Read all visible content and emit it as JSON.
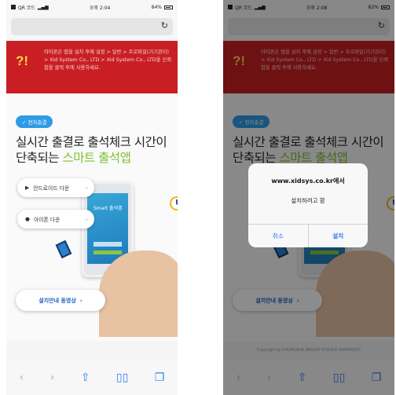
{
  "left": {
    "status": {
      "carrier": "QR 코드",
      "time": "오후 2:04",
      "battery": "84%"
    },
    "banner": {
      "mark": "?!",
      "text": "아이폰은 앱을 설치 후에 설정 > 일반 > 프로파일(기기관리) > Xid System Co., LTD > Xid System Co., LTD을 신뢰함을 클릭 후에 사용하세요."
    },
    "badge": "✓ 전자출결",
    "headline_line1": "실시간 출결로 출석체크 시간이",
    "headline_line2_plain": "단축되는 ",
    "headline_line2_green": "스마트 출석앱",
    "android_btn": "안드로이드 다운",
    "ios_btn": "아이폰 다운",
    "phone_app_label": "Smart 출석앱",
    "guide_btn": "설치안내 동영상"
  },
  "right": {
    "status": {
      "carrier": "QR 코드",
      "time": "오후 2:08",
      "battery": "82%"
    },
    "banner": {
      "mark": "?!",
      "text": "아이폰은 앱을 설치 후에 설정 > 일반 > 프로파일(기기관리) > Xid System Co., LTD > Xid System Co., LTD을 신뢰함을 클릭 후에 사용하세요."
    },
    "badge": "✓ 전자출결",
    "headline_line1": "실시간 출결로 출석체크 시간이",
    "headline_line2_plain": "단축되는 ",
    "headline_line2_green": "스마트 출석앱",
    "guide_btn": "설치안내 동영상",
    "footer": "Copyright by CHONGBUK HEALTH SCIENCE UNIVERSITY",
    "dialog": {
      "title": "www.xidsys.co.kr에서",
      "message": "설치하려고 함",
      "cancel": "취소",
      "install": "설치"
    }
  },
  "colors": {
    "banner": "#c91f24",
    "badge": "#2e9be6",
    "accent_green": "#7cbf2e",
    "link_blue": "#2c74ed"
  }
}
